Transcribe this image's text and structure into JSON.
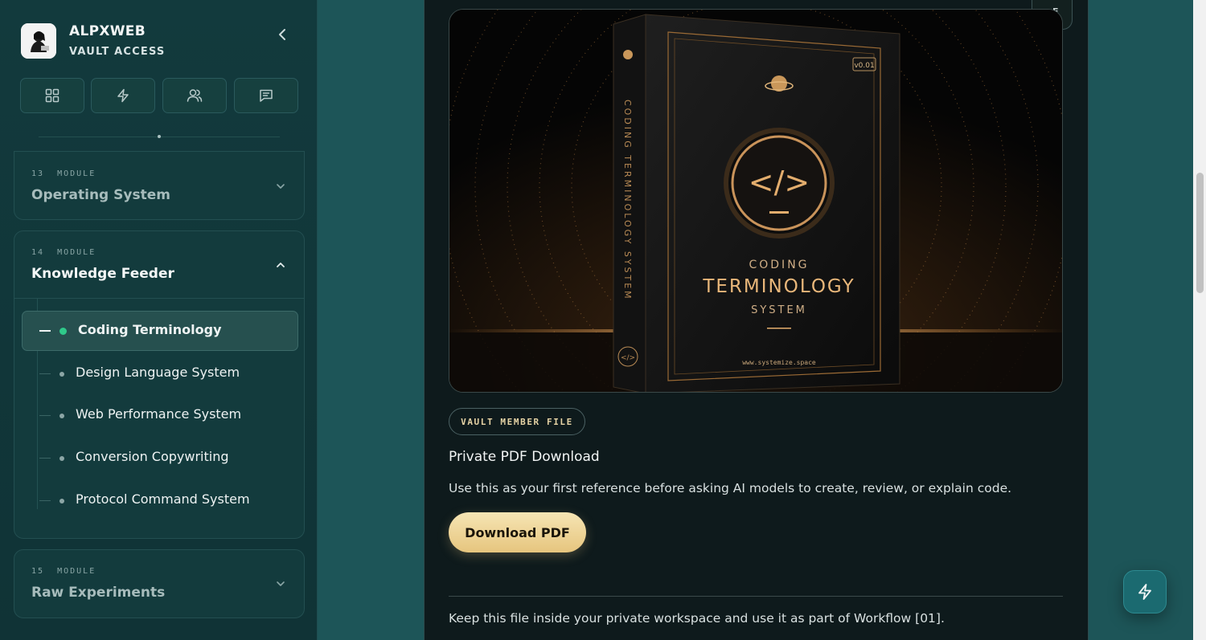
{
  "brand": {
    "name": "ALPXWEB",
    "subtitle": "VAULT ACCESS"
  },
  "quick_actions": [
    {
      "icon": "grid-icon"
    },
    {
      "icon": "lightning-icon"
    },
    {
      "icon": "users-icon"
    },
    {
      "icon": "message-icon"
    }
  ],
  "modules": [
    {
      "number": "13",
      "tag": "MODULE",
      "title": "Operating System",
      "expanded": false
    },
    {
      "number": "14",
      "tag": "MODULE",
      "title": "Knowledge Feeder",
      "expanded": true,
      "lessons": [
        {
          "label": "Coding Terminology",
          "active": true
        },
        {
          "label": "Design Language System",
          "active": false
        },
        {
          "label": "Web Performance System",
          "active": false
        },
        {
          "label": "Conversion Copywriting",
          "active": false
        },
        {
          "label": "Protocol Command System",
          "active": false
        }
      ]
    },
    {
      "number": "15",
      "tag": "MODULE",
      "title": "Raw Experiments",
      "expanded": false
    }
  ],
  "top_chip": {
    "label": "F"
  },
  "cover": {
    "spine": "CODING TERMINOLOGY SYSTEM",
    "version": "v0.01",
    "code_glyph": "</>",
    "line1": "CODING",
    "line2": "TERMINOLOGY",
    "line3": "SYSTEM",
    "url": "www.systemize.space"
  },
  "file": {
    "badge": "VAULT MEMBER FILE",
    "title": "Private PDF Download",
    "description": "Use this as your first reference before asking AI models to create, review, or explain code.",
    "button": "Download PDF",
    "footnote": "Keep this file inside your private workspace and use it as part of Workflow [01]."
  },
  "colors": {
    "accent_gold": "#e6c57e",
    "active_dot": "#2fc98a",
    "sidebar_bg": "#123a3d",
    "page_bg": "#1d5558"
  }
}
